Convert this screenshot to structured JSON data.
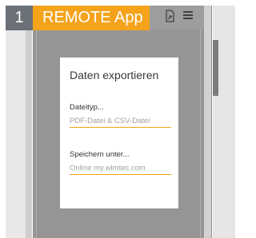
{
  "step_number": "1",
  "app_title": "REMOTE App",
  "toolbar": {
    "export_icon": "export-icon",
    "menu_icon": "hamburger-menu-icon"
  },
  "dialog": {
    "title": "Daten exportieren",
    "fields": [
      {
        "label": "Dateityp...",
        "value": "PDF-Datei & CSV-Datei"
      },
      {
        "label": "Speichern unter...",
        "value": "Online my.wimtec.com"
      }
    ]
  },
  "colors": {
    "accent": "#f4a31b",
    "badge": "#6b7177",
    "overlay": "#959595"
  }
}
